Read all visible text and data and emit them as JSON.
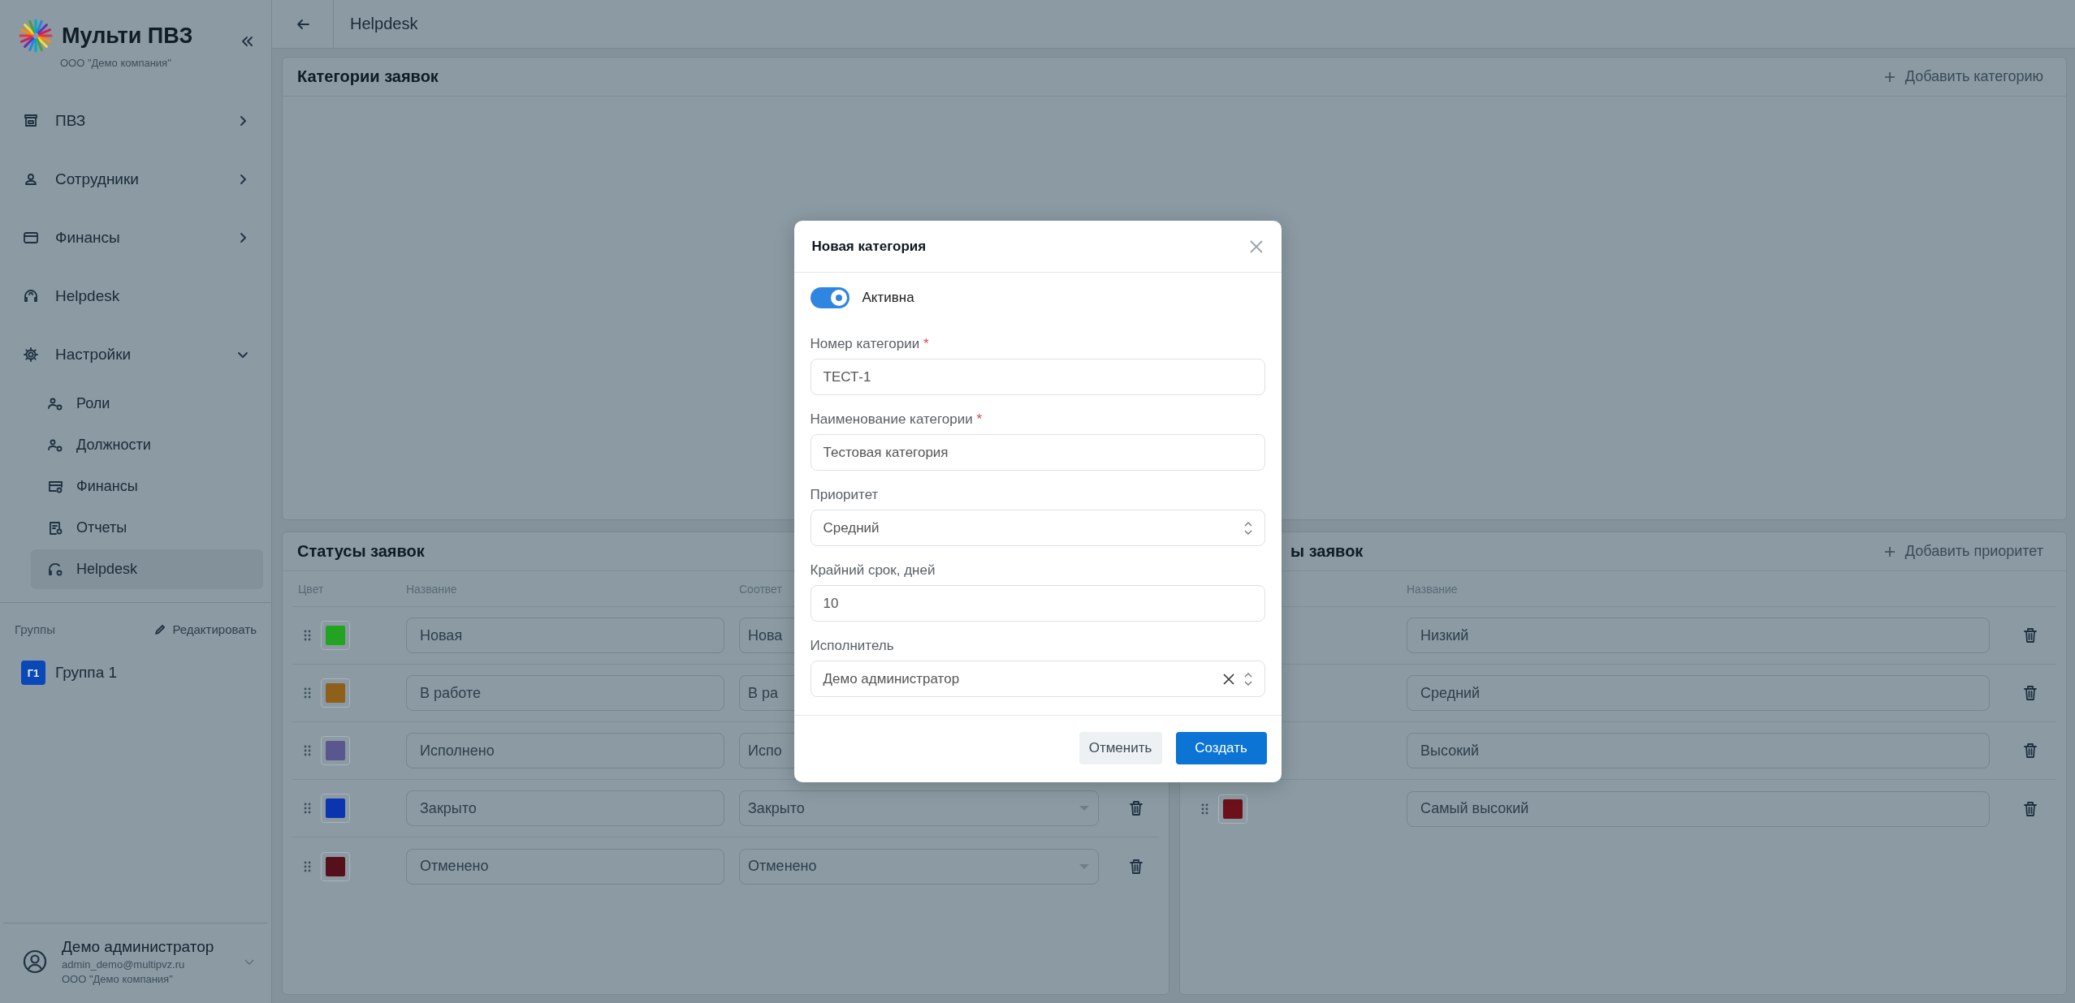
{
  "sidebar": {
    "brand": "Мульти ПВЗ",
    "company": "ООО \"Демо компания\"",
    "menu": [
      {
        "label": "ПВЗ",
        "expanded": false
      },
      {
        "label": "Сотрудники",
        "expanded": false
      },
      {
        "label": "Финансы",
        "expanded": false
      },
      {
        "label": "Helpdesk"
      },
      {
        "label": "Настройки",
        "expanded": true,
        "children": [
          {
            "label": "Роли",
            "selected": false
          },
          {
            "label": "Должности",
            "selected": false
          },
          {
            "label": "Финансы",
            "selected": false
          },
          {
            "label": "Отчеты",
            "selected": false
          },
          {
            "label": "Helpdesk",
            "selected": true
          }
        ]
      }
    ],
    "groups": {
      "title": "Группы",
      "edit": "Редактировать",
      "items": [
        {
          "badge": "Г1",
          "label": "Группа 1"
        }
      ]
    },
    "user": {
      "name": "Демо администратор",
      "email": "admin_demo@multipvz.ru",
      "company": "ООО \"Демо компания\""
    }
  },
  "header": {
    "title": "Helpdesk"
  },
  "categories_panel": {
    "title": "Категории заявок",
    "add_button": "Добавить категорию"
  },
  "statuses_panel": {
    "title": "Статусы заявок",
    "columns": [
      "Цвет",
      "Название",
      "Соответ"
    ],
    "rows": [
      {
        "color": "#22a322",
        "name": "Новая",
        "mapping": "Нова"
      },
      {
        "color": "#8f5f1c",
        "name": "В работе",
        "mapping": "В ра"
      },
      {
        "color": "#5a568e",
        "name": "Исполнено",
        "mapping": "Испо"
      },
      {
        "color": "#0a34b0",
        "name": "Закрыто",
        "mapping": "Закрыто",
        "deletable": true
      },
      {
        "color": "#56101c",
        "name": "Отменено",
        "mapping": "Отменено",
        "deletable": true
      }
    ]
  },
  "priorities_panel": {
    "title": "ы заявок",
    "add_button": "Добавить приоритет",
    "columns": [
      "Название"
    ],
    "rows": [
      {
        "name": "Низкий"
      },
      {
        "name": "Средний"
      },
      {
        "name": "Высокий"
      },
      {
        "color": "#6e101c",
        "name": "Самый высокий"
      }
    ]
  },
  "dialog": {
    "title": "Новая категория",
    "toggle": {
      "label": "Активна",
      "on": true
    },
    "fields": [
      {
        "kind": "text",
        "label": "Номер категории",
        "required_mark": "*",
        "value": "ТЕСТ-1"
      },
      {
        "kind": "text",
        "label": "Наименование категории",
        "required_mark": "*",
        "value": "Тестовая категория"
      },
      {
        "kind": "select",
        "label": "Приоритет",
        "value": "Средний"
      },
      {
        "kind": "text",
        "label": "Крайний срок, дней",
        "value": "10"
      },
      {
        "kind": "select",
        "label": "Исполнитель",
        "value": "Демо администратор",
        "clearable": true
      }
    ],
    "buttons": [
      {
        "label": "Отменить",
        "kind": "secondary"
      },
      {
        "label": "Создать",
        "kind": "primary"
      }
    ]
  }
}
